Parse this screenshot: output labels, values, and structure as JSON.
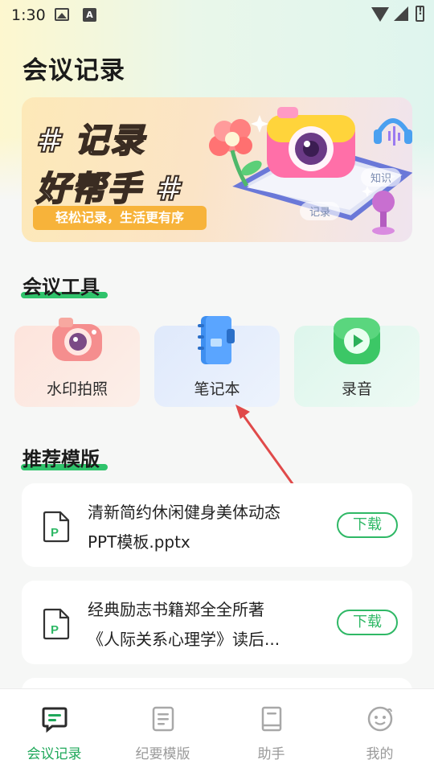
{
  "status_bar": {
    "time": "1:30"
  },
  "page": {
    "title": "会议记录"
  },
  "banner": {
    "line1": "# 记录",
    "line2": "好帮手 #",
    "subtitle": "轻松记录，生活更有序",
    "tag_knowledge": "知识",
    "tag_record": "记录"
  },
  "tools": {
    "section_title": "会议工具",
    "items": [
      {
        "label": "水印拍照",
        "icon": "camera-icon"
      },
      {
        "label": "笔记本",
        "icon": "notebook-icon"
      },
      {
        "label": "录音",
        "icon": "play-icon"
      }
    ]
  },
  "templates": {
    "section_title": "推荐模版",
    "items": [
      {
        "line1": "清新简约休闲健身美体动态",
        "line2": "PPT模板.pptx",
        "download_label": "下载",
        "icon": "ppt-file-icon"
      },
      {
        "line1": "经典励志书籍郑全全所著",
        "line2": "《人际关系心理学》读后...",
        "download_label": "下载",
        "icon": "ppt-file-icon"
      }
    ]
  },
  "bottom_nav": {
    "items": [
      {
        "label": "会议记录",
        "active": true,
        "icon": "chat-note-icon"
      },
      {
        "label": "纪要模版",
        "active": false,
        "icon": "document-icon"
      },
      {
        "label": "助手",
        "active": false,
        "icon": "book-icon"
      },
      {
        "label": "我的",
        "active": false,
        "icon": "smile-face-icon"
      }
    ]
  },
  "colors": {
    "accent": "#2fb866",
    "annotation_arrow": "#e04a4a"
  }
}
